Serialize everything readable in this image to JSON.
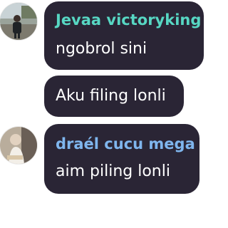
{
  "colors": {
    "bubble_bg": "#2a2535",
    "message_text": "#ffffff",
    "name_teal": "#57d7c3",
    "name_blue": "#7fb6ee"
  },
  "messages": [
    {
      "sender": "Jevaa victoryking",
      "sender_color": "#57d7c3",
      "text": "ngobrol sini",
      "avatar_icon": "avatar-photo-icon"
    },
    {
      "sender": "",
      "text": "Aku filing lonli"
    },
    {
      "sender": "draél cucu mega",
      "sender_color": "#7fb6ee",
      "text": "aim piling lonli",
      "avatar_icon": "avatar-photo-icon"
    }
  ]
}
